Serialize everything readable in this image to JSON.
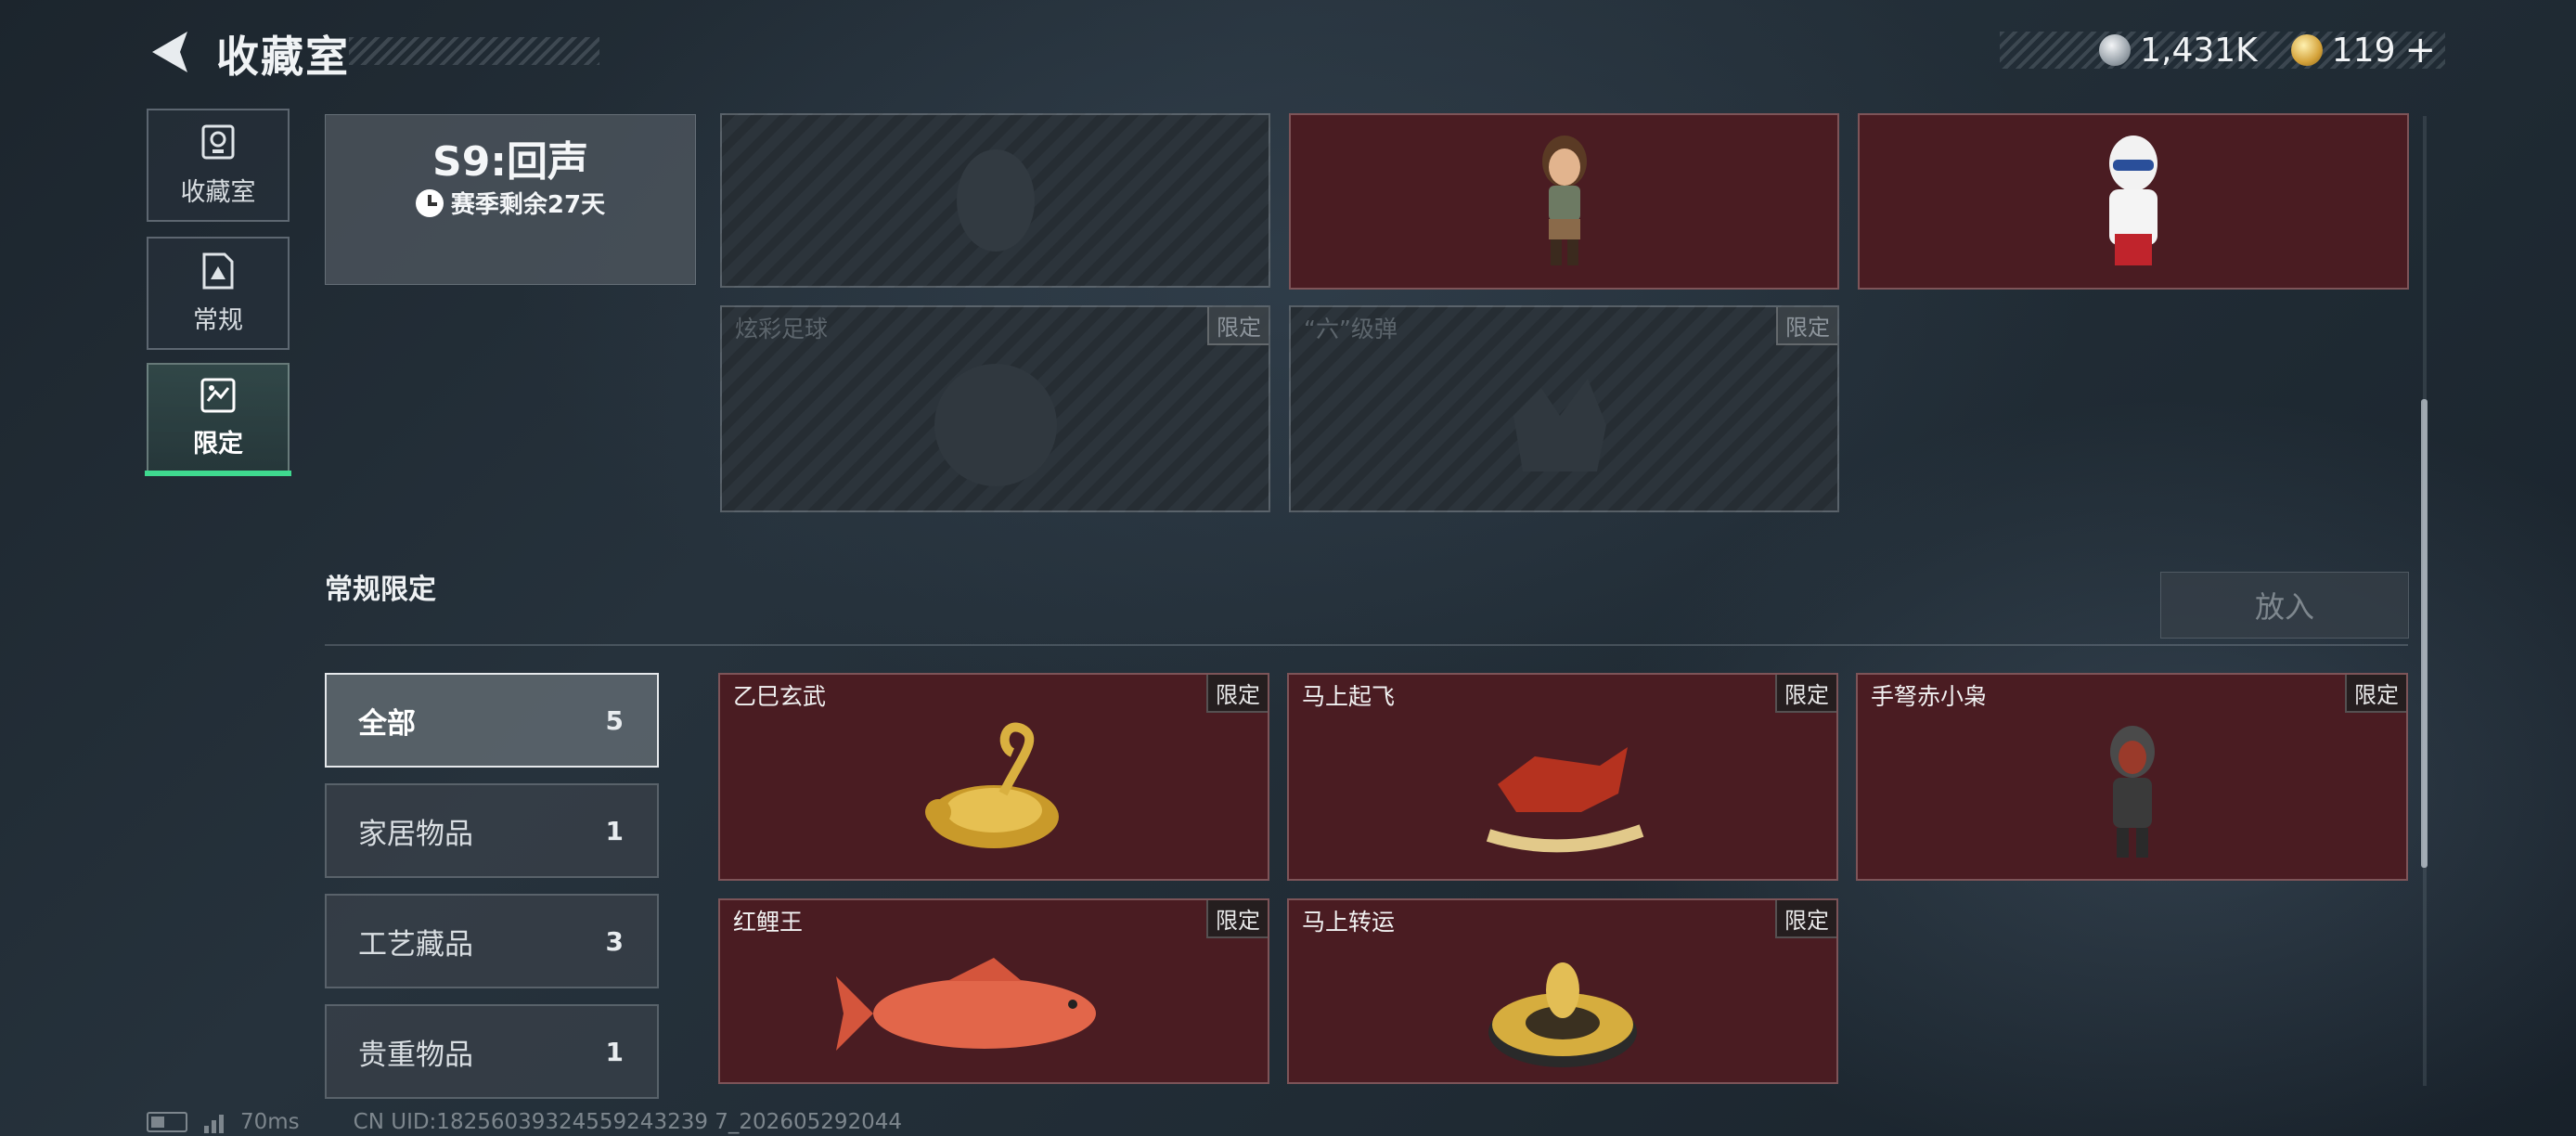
{
  "header": {
    "title": "收藏室"
  },
  "currency": {
    "silver": "1,431K",
    "gold": "119",
    "plus": "+"
  },
  "nav": [
    {
      "label": "收藏室",
      "icon": "trophy-icon"
    },
    {
      "label": "常规",
      "icon": "document-icon"
    },
    {
      "label": "限定",
      "icon": "map-icon"
    }
  ],
  "season": {
    "title": "S9:回声",
    "remaining": "赛季剩余27天"
  },
  "top_cards": [
    {
      "name": "",
      "tag": "",
      "state": "locked"
    },
    {
      "name": "",
      "tag": "",
      "state": "owned"
    },
    {
      "name": "",
      "tag": "",
      "state": "owned"
    },
    {
      "name": "炫彩足球",
      "tag": "限定",
      "state": "locked"
    },
    {
      "name": "“六”级弹",
      "tag": "限定",
      "state": "locked"
    }
  ],
  "section": {
    "title": "常规限定",
    "put_in": "放入"
  },
  "filters": [
    {
      "label": "全部",
      "count": "5"
    },
    {
      "label": "家居物品",
      "count": "1"
    },
    {
      "label": "工艺藏品",
      "count": "3"
    },
    {
      "label": "贵重物品",
      "count": "1"
    }
  ],
  "items": [
    {
      "name": "乙巳玄武",
      "tag": "限定"
    },
    {
      "name": "马上起飞",
      "tag": "限定"
    },
    {
      "name": "手弩赤小枭",
      "tag": "限定"
    },
    {
      "name": "红鲤王",
      "tag": "限定"
    },
    {
      "name": "马上转运",
      "tag": "限定"
    }
  ],
  "status": {
    "ping": "70ms",
    "uid": "CN UID:18256039324559243239 7_202605292044"
  },
  "colors": {
    "accent_green": "#3fd98f",
    "card_red": "#4a1c22"
  }
}
